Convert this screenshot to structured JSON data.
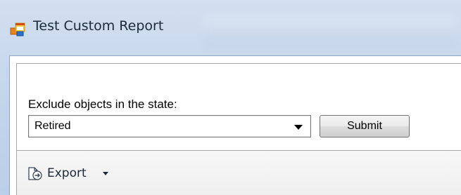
{
  "window": {
    "title": "Test Custom Report",
    "icon": "app-window-icon"
  },
  "filter": {
    "label": "Exclude objects in the state:",
    "state_select": {
      "value": "Retired",
      "icon": "chevron-down-icon"
    },
    "submit_label": "Submit"
  },
  "toolbar": {
    "export_label": "Export",
    "export_icon": "export-icon",
    "export_dropdown_icon": "caret-down-icon"
  }
}
